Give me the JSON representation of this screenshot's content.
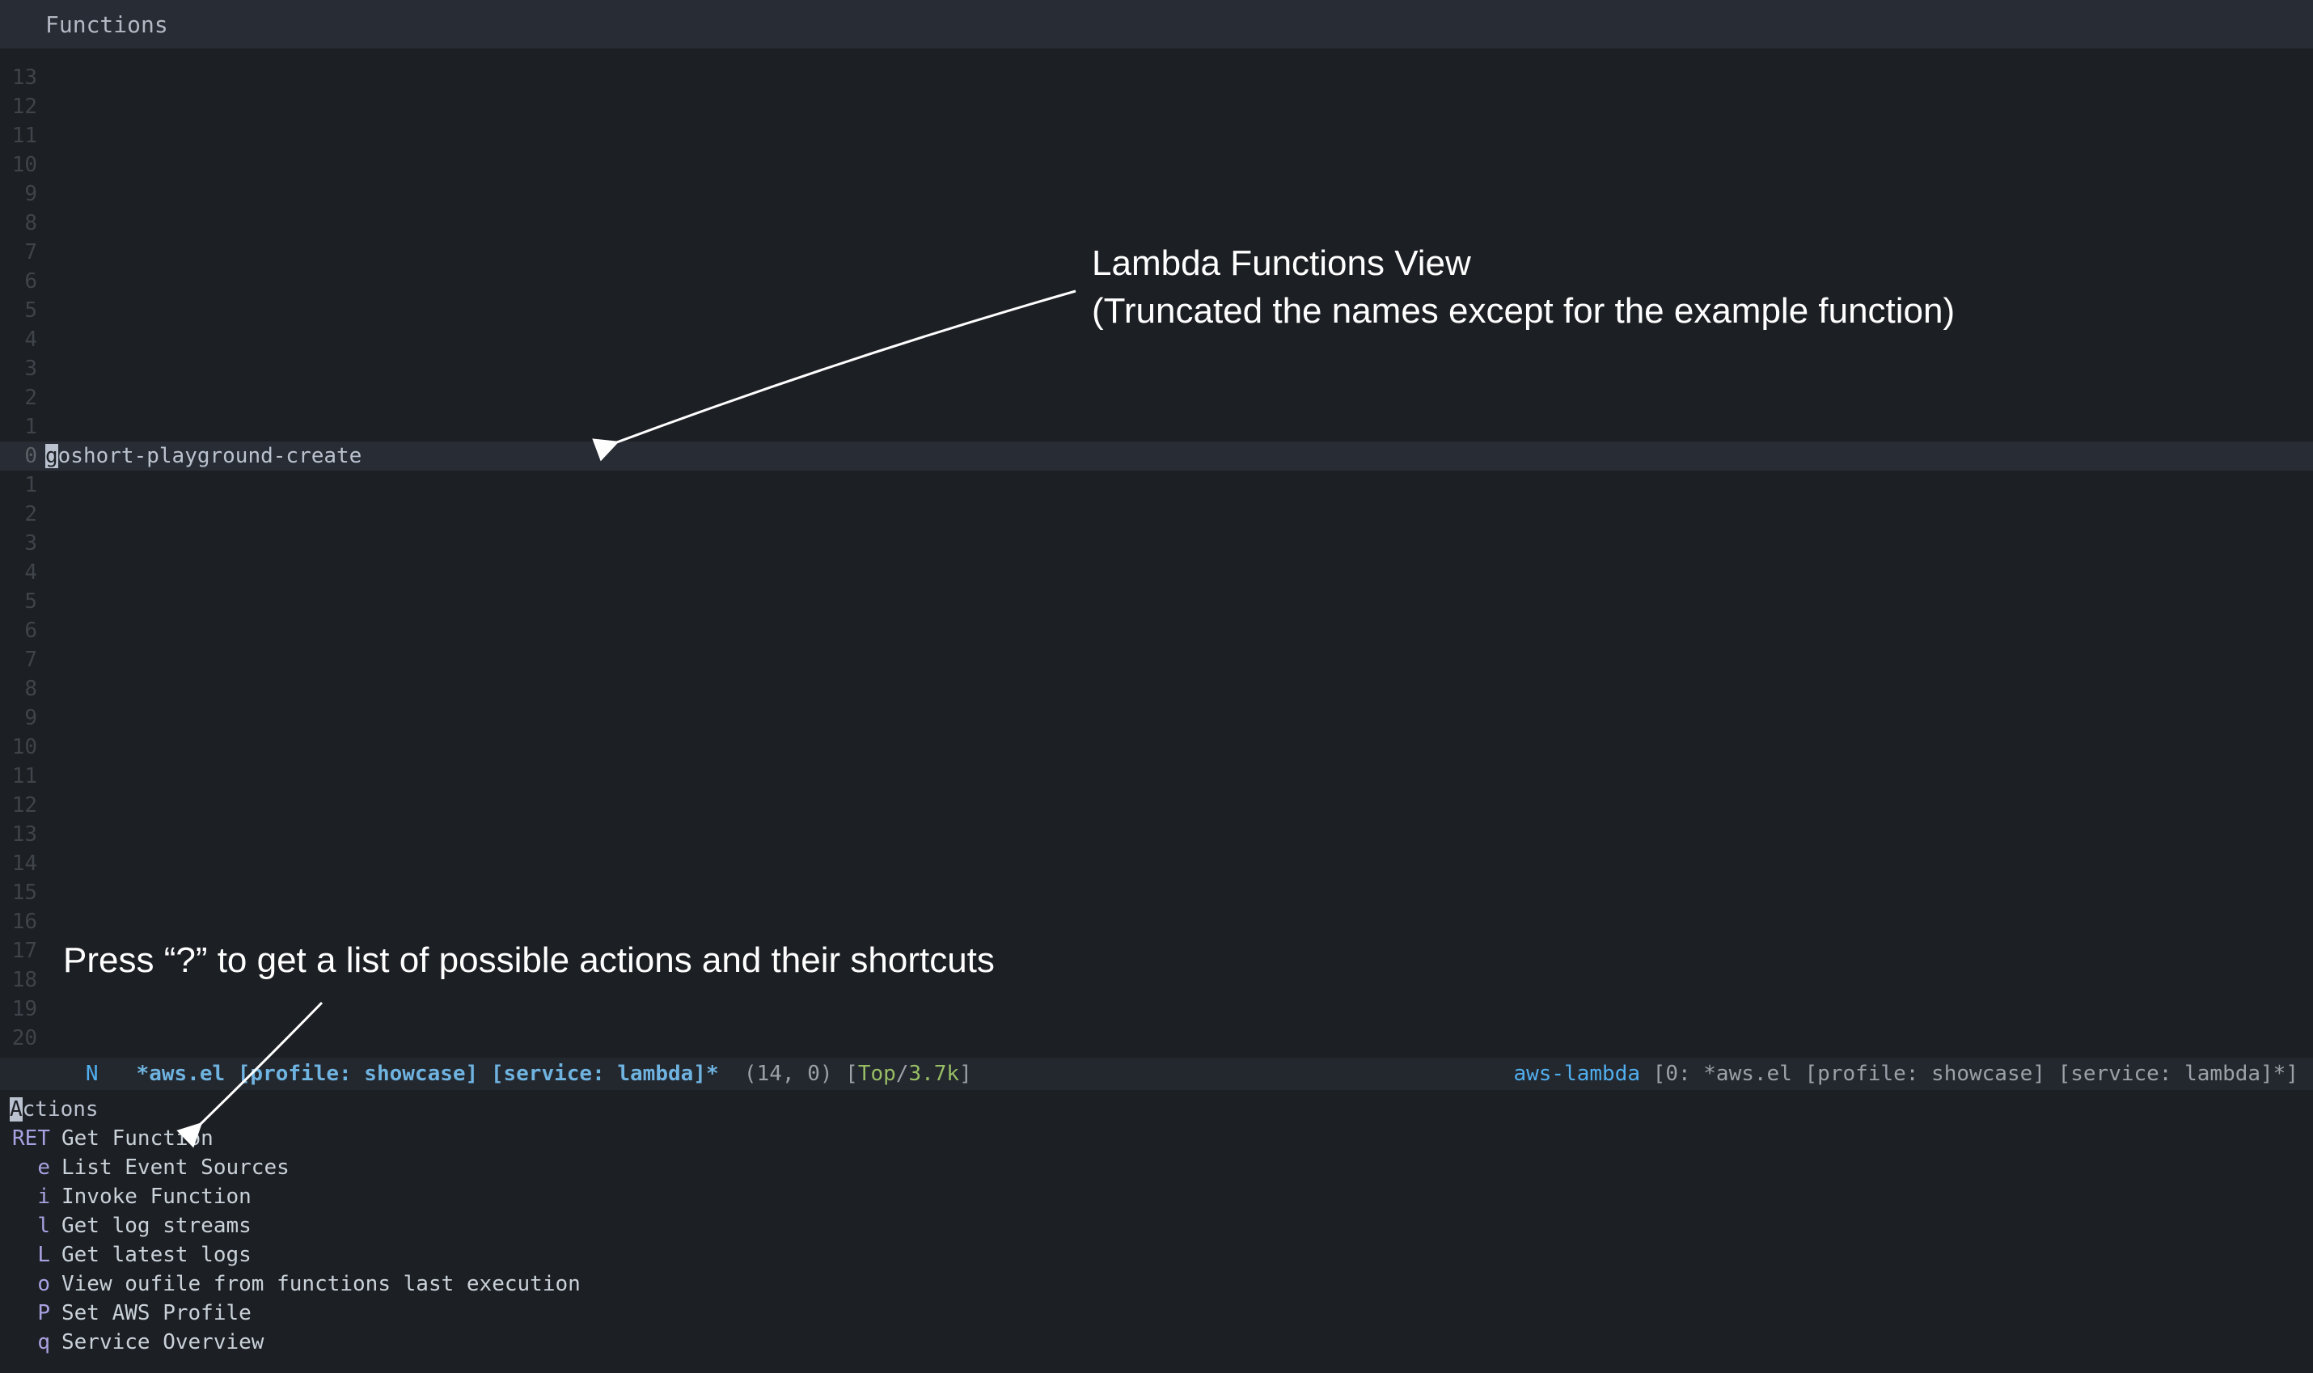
{
  "header": {
    "title": "Functions"
  },
  "buffer": {
    "current_line_text": "goshort-playground-create",
    "current_char": "g",
    "gutter_above": [
      "13",
      "12",
      "11",
      "10",
      "9",
      "8",
      "7",
      "6",
      "5",
      "4",
      "3",
      "2",
      "1"
    ],
    "gutter_current": "0",
    "gutter_below": [
      "1",
      "2",
      "3",
      "4",
      "5",
      "6",
      "7",
      "8",
      "9",
      "10",
      "11",
      "12",
      "13",
      "14",
      "15",
      "16",
      "17",
      "18",
      "19",
      "20"
    ]
  },
  "modeline": {
    "indicator": "N",
    "buffer_name": "*aws.el [profile: showcase] [service: lambda]*",
    "cursor": "(14, 0)",
    "brL": "[",
    "top_word": "Top",
    "slash": "/",
    "size": "3.7k",
    "brR": "]",
    "right_mode": "aws-lambda",
    "right_tail": " [0: *aws.el [profile: showcase] [service: lambda]*]"
  },
  "actions": {
    "title_char": "A",
    "title_rest": "ctions",
    "items": [
      {
        "key": "RET",
        "desc": "Get Function"
      },
      {
        "key": "e",
        "desc": "List Event Sources"
      },
      {
        "key": "i",
        "desc": "Invoke Function"
      },
      {
        "key": "l",
        "desc": "Get log streams"
      },
      {
        "key": "L",
        "desc": "Get latest logs"
      },
      {
        "key": "o",
        "desc": "View oufile from functions last execution"
      },
      {
        "key": "P",
        "desc": "Set AWS Profile"
      },
      {
        "key": "q",
        "desc": "Service Overview"
      }
    ]
  },
  "annotations": {
    "a1_line1": "Lambda Functions View",
    "a1_line2": "(Truncated the names except for the example function)",
    "a2": "Press “?” to get a list of possible actions and their shortcuts"
  }
}
